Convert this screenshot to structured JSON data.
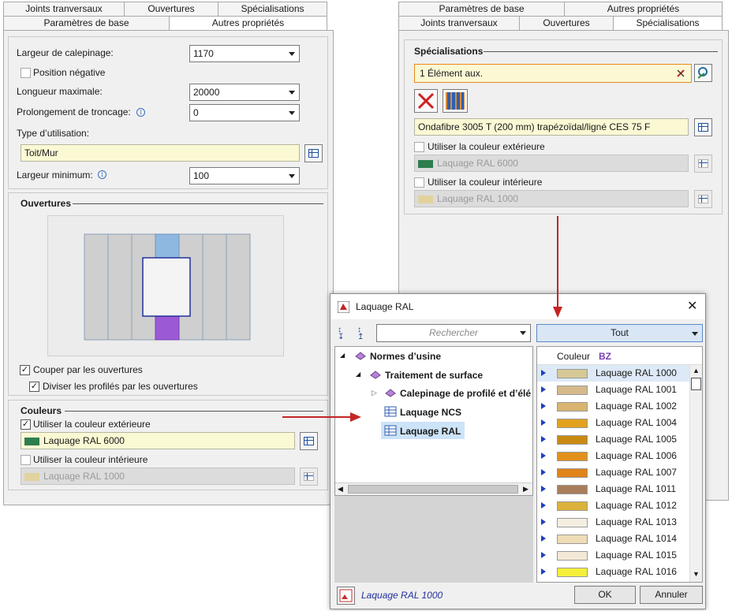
{
  "left_panel": {
    "tabs_row1": [
      "Joints tranversaux",
      "Ouvertures",
      "Spécialisations"
    ],
    "tabs_row2": [
      "Paramètres de base",
      "Autres propriétés"
    ],
    "largeur_label": "Largeur de calepinage:",
    "largeur_value": "1170",
    "position_negative": "Position négative",
    "longueur_label": "Longueur maximale:",
    "longueur_value": "20000",
    "prolongement_label": "Prolongement de troncage:",
    "prolongement_value": "0",
    "type_label": "Type d’utilisation:",
    "type_value": "Toit/Mur",
    "largeur_min_label": "Largeur minimum:",
    "largeur_min_value": "100",
    "ouvertures_title": "Ouvertures",
    "couper": "Couper par les ouvertures",
    "diviser": "Diviser les profilés par les ouvertures",
    "couleurs_title": "Couleurs",
    "util_ext": "Utiliser la couleur extérieure",
    "ext_value": "Laquage RAL 6000",
    "util_int": "Utiliser la couleur intérieure",
    "int_value": "Laquage RAL 1000"
  },
  "right_panel": {
    "tabs_row1": [
      "Paramètres de base",
      "Autres propriétés"
    ],
    "tabs_row2": [
      "Joints tranversaux",
      "Ouvertures",
      "Spécialisations"
    ],
    "spec_title": "Spécialisations",
    "element_value": "1 Élément aux.",
    "product_value": "Ondafibre 3005 T (200 mm) trapézoïdal/ligné CES 75 F",
    "util_ext": "Utiliser la couleur extérieure",
    "ext_value": "Laquage RAL 6000",
    "util_int": "Utiliser la couleur intérieure",
    "int_value": "Laquage RAL 1000"
  },
  "dialog": {
    "title": "Laquage RAL",
    "search_placeholder": "Rechercher",
    "filter_value": "Tout",
    "tree": [
      "Normes d’usine",
      "Traitement de surface",
      "Calepinage de profilé et d’élé",
      "Laquage NCS",
      "Laquage RAL"
    ],
    "col_couleur": "Couleur",
    "col_bz": "BZ",
    "rows": [
      {
        "name": "Laquage RAL 1000",
        "color": "#d6c996"
      },
      {
        "name": "Laquage RAL 1001",
        "color": "#d6b98a"
      },
      {
        "name": "Laquage RAL 1002",
        "color": "#d9b470"
      },
      {
        "name": "Laquage RAL 1004",
        "color": "#e2a21e"
      },
      {
        "name": "Laquage RAL 1005",
        "color": "#c98a12"
      },
      {
        "name": "Laquage RAL 1006",
        "color": "#e2901a"
      },
      {
        "name": "Laquage RAL 1007",
        "color": "#e08318"
      },
      {
        "name": "Laquage RAL 1011",
        "color": "#a97d5a"
      },
      {
        "name": "Laquage RAL 1012",
        "color": "#dcb23a"
      },
      {
        "name": "Laquage RAL 1013",
        "color": "#f4efe0"
      },
      {
        "name": "Laquage RAL 1014",
        "color": "#eeddb6"
      },
      {
        "name": "Laquage RAL 1015",
        "color": "#f4e9d6"
      },
      {
        "name": "Laquage RAL 1016",
        "color": "#f5ef3a"
      }
    ],
    "status": "Laquage RAL 1000",
    "ok": "OK",
    "cancel": "Annuler"
  },
  "colors": {
    "green": "#2e7d4f",
    "beige": "#e1d39d",
    "accent": "#cc2222"
  }
}
